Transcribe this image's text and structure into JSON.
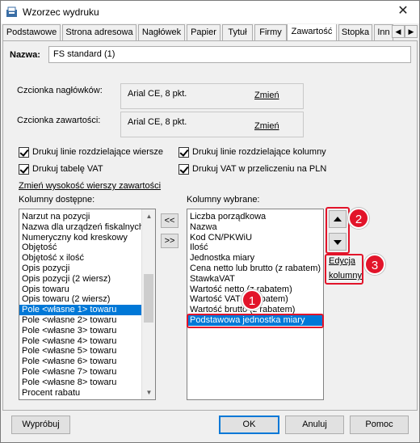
{
  "window": {
    "title": "Wzorzec wydruku",
    "close_glyph": "✕"
  },
  "tabs": [
    {
      "label": "Podstawowe"
    },
    {
      "label": "Strona adresowa"
    },
    {
      "label": "Nagłówek"
    },
    {
      "label": "Papier"
    },
    {
      "label": "Tytuł"
    },
    {
      "label": "Firmy"
    },
    {
      "label": "Zawartość"
    },
    {
      "label": "Stopka"
    },
    {
      "label": "Inn"
    }
  ],
  "tab_scroll": {
    "left_glyph": "◀",
    "right_glyph": "▶"
  },
  "name": {
    "label": "Nazwa:",
    "value": "FS standard (1)"
  },
  "fonts": {
    "header_label": "Czcionka nagłówków:",
    "header_value": "Arial CE, 8 pkt.",
    "content_label": "Czcionka zawartości:",
    "content_value": "Arial CE, 8 pkt.",
    "change_label": "Zmień"
  },
  "checkboxes": [
    {
      "label": "Drukuj linie rozdzielające wiersze",
      "checked": true
    },
    {
      "label": "Drukuj linie rozdzielające kolumny",
      "checked": true
    },
    {
      "label": "Drukuj tabelę VAT",
      "checked": true
    },
    {
      "label": "Drukuj VAT w przeliczeniu na PLN",
      "checked": true
    }
  ],
  "row_height_link": "Zmień wysokość wierszy zawartości",
  "available": {
    "label": "Kolumny dostępne:",
    "items": [
      "Narzut na pozycji",
      "Nazwa dla urządzeń fiskalnych",
      "Numeryczny kod kreskowy",
      "Objętość",
      "Objętość x ilość",
      "Opis pozycji",
      "Opis pozycji (2 wiersz)",
      "Opis towaru",
      "Opis towaru (2 wiersz)",
      "Pole <własne 1> towaru",
      "Pole <własne 2> towaru",
      "Pole <własne 3> towaru",
      "Pole <własne 4> towaru",
      "Pole <własne 5> towaru",
      "Pole <własne 6> towaru",
      "Pole <własne 7> towaru",
      "Pole <własne 8> towaru",
      "Procent rabatu"
    ],
    "selected_index": 9
  },
  "move": {
    "left": "<<",
    "right": ">>"
  },
  "chosen": {
    "label": "Kolumny wybrane:",
    "items": [
      "Liczba porządkowa",
      "Nazwa",
      "Kod CN/PKWiU",
      "Ilość",
      "Jednostka miary",
      "Cena netto lub brutto (z rabatem)",
      "StawkaVAT",
      "Wartość netto (z rabatem)",
      "Wartość VAT (z rabatem)",
      "Wartość brutto (z rabatem)",
      "Podstawowa jednostka miary"
    ],
    "selected_index": 10
  },
  "edit": {
    "line1": "Edycja",
    "line2": "kolumny"
  },
  "badges": {
    "one": "1",
    "two": "2",
    "three": "3"
  },
  "footer": {
    "preview": "Wypróbuj",
    "ok": "OK",
    "cancel": "Anuluj",
    "help": "Pomoc"
  },
  "colors": {
    "accent": "#0078d7",
    "highlight": "#e2142a"
  }
}
